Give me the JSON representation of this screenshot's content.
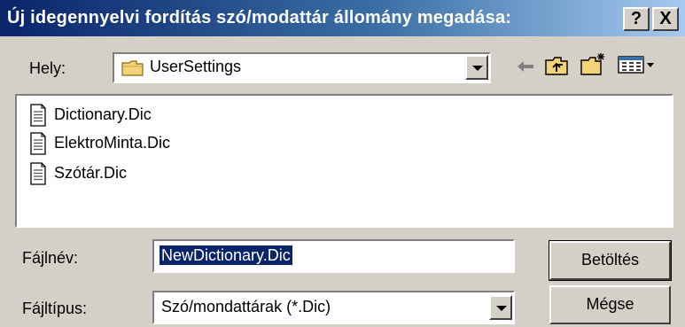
{
  "window": {
    "title": "Új idegennyelvi fordítás szó/modattár állomány megadása:",
    "help_label": "?",
    "close_label": "X"
  },
  "location": {
    "label": "Hely:",
    "value": "UserSettings",
    "folder_icon": "folder-icon"
  },
  "toolbar": {
    "back_icon": "back-arrow-icon",
    "up_icon": "up-folder-icon",
    "new_folder_icon": "new-folder-icon",
    "view_menu_icon": "view-menu-icon"
  },
  "files": [
    {
      "name": "Dictionary.Dic"
    },
    {
      "name": "ElektroMinta.Dic"
    },
    {
      "name": "Szótár.Dic"
    }
  ],
  "filename": {
    "label": "Fájlnév:",
    "value": "NewDictionary.Dic"
  },
  "filetype": {
    "label": "Fájltípus:",
    "value": "Szó/mondattárak (*.Dic)"
  },
  "buttons": {
    "open_label": "Betöltés",
    "cancel_label": "Mégse"
  },
  "colors": {
    "title_active": "#0a246a",
    "title_gradient_end": "#a6caf0",
    "face": "#d4d0c8",
    "selection": "#0a246a"
  }
}
